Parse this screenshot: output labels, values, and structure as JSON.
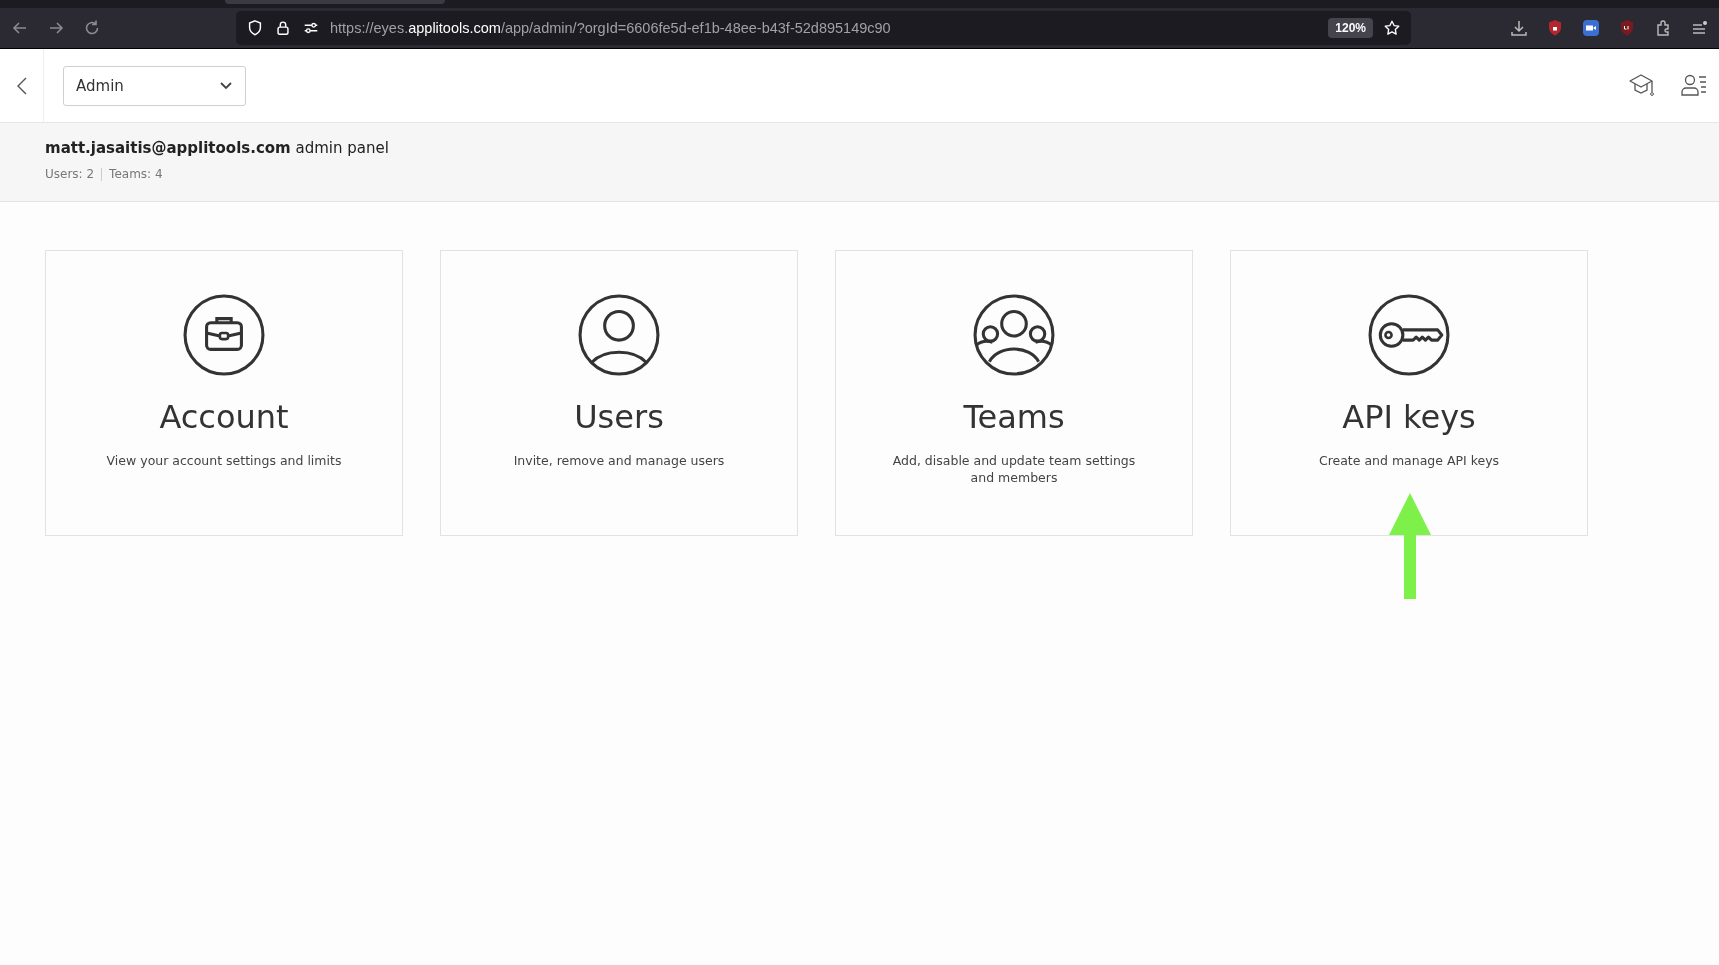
{
  "browser": {
    "url": "https://eyes.**applitools.com**/app/admin/?orgId=6606fe5d-ef1b-48ee-b43f-52d895149c90",
    "zoom": "120%"
  },
  "header": {
    "view_select": {
      "value": "Admin"
    }
  },
  "info": {
    "title": "**matt.jasaitis@applitools.com** admin panel",
    "stats": [
      "Users: 2",
      "Teams: 4"
    ]
  },
  "cards": [
    {
      "kind": "account",
      "title": "Account",
      "description": "View your account settings and limits"
    },
    {
      "kind": "users",
      "title": "Users",
      "description": "Invite, remove and manage users"
    },
    {
      "kind": "teams",
      "title": "Teams",
      "description": "Add, disable and update team settings and members"
    },
    {
      "kind": "keys",
      "title": "API keys",
      "description": "Create and manage API keys"
    }
  ]
}
